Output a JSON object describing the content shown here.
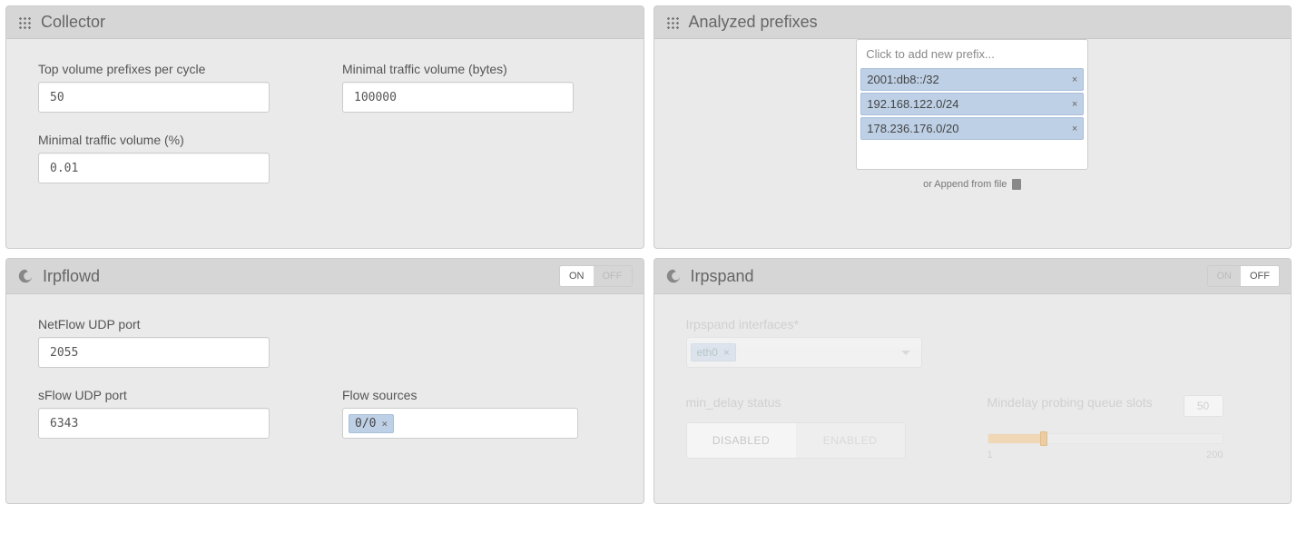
{
  "collector": {
    "title": "Collector",
    "top_prefixes_label": "Top volume prefixes per cycle",
    "top_prefixes_value": "50",
    "min_bytes_label": "Minimal traffic volume (bytes)",
    "min_bytes_value": "100000",
    "min_pct_label": "Minimal traffic volume (%)",
    "min_pct_value": "0.01"
  },
  "analyzed": {
    "title": "Analyzed prefixes",
    "placeholder": "Click to add new prefix...",
    "prefixes": {
      "0": "2001:db8::/32",
      "1": "192.168.122.0/24",
      "2": "178.236.176.0/20"
    },
    "append_text": "or Append from file"
  },
  "irpflowd": {
    "title": "Irpflowd",
    "on": "ON",
    "off": "OFF",
    "netflow_label": "NetFlow UDP port",
    "netflow_value": "2055",
    "sflow_label": "sFlow UDP port",
    "sflow_value": "6343",
    "sources_label": "Flow sources",
    "source_tag": "0/0"
  },
  "irpspand": {
    "title": "Irpspand",
    "on": "ON",
    "off": "OFF",
    "iface_label": "Irpspand interfaces*",
    "iface_tag": "eth0",
    "min_delay_label": "min_delay status",
    "disabled": "DISABLED",
    "enabled": "ENABLED",
    "queue_label": "Mindelay probing queue slots",
    "queue_value": "50",
    "slider_min": "1",
    "slider_max": "200"
  }
}
